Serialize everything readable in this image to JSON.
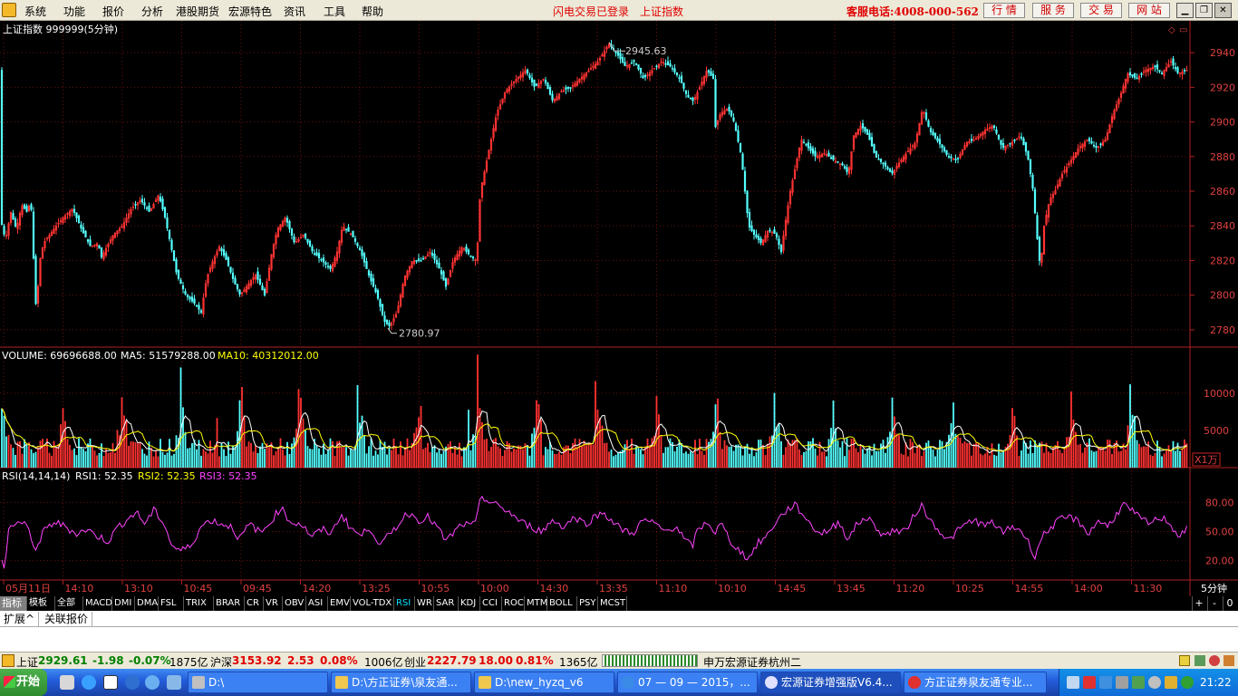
{
  "menubar": {
    "items": [
      "系统",
      "功能",
      "报价",
      "分析",
      "港股期货",
      "宏源特色",
      "资讯",
      "工具",
      "帮助"
    ],
    "flash_login": "闪电交易已登录",
    "index_name": "上证指数",
    "hotline": "客服电话:4008-000-562",
    "buttons": [
      "行 情",
      "服 务",
      "交 易",
      "网 站"
    ],
    "window_icons": [
      "minimize-icon",
      "restore-icon",
      "close-icon"
    ]
  },
  "chart_data": [
    {
      "type": "candlestick",
      "name": "main",
      "title": "上证指数 999999(5分钟)",
      "ylim": [
        2770,
        2950
      ],
      "yticks": [
        2780,
        2800,
        2820,
        2840,
        2860,
        2880,
        2900,
        2920,
        2940
      ],
      "high_label": "2945.63",
      "low_label": "2780.97",
      "close_path": [
        [
          0,
          2845
        ],
        [
          6,
          2832
        ],
        [
          12,
          2848
        ],
        [
          18,
          2838
        ],
        [
          24,
          2852
        ],
        [
          30,
          2848
        ],
        [
          34,
          2855
        ],
        [
          38,
          2810
        ],
        [
          40,
          2790
        ],
        [
          44,
          2820
        ],
        [
          48,
          2830
        ],
        [
          55,
          2835
        ],
        [
          62,
          2840
        ],
        [
          70,
          2845
        ],
        [
          80,
          2850
        ],
        [
          90,
          2838
        ],
        [
          100,
          2828
        ],
        [
          108,
          2830
        ],
        [
          112,
          2822
        ],
        [
          118,
          2828
        ],
        [
          125,
          2835
        ],
        [
          135,
          2840
        ],
        [
          145,
          2850
        ],
        [
          155,
          2855
        ],
        [
          165,
          2848
        ],
        [
          175,
          2858
        ],
        [
          182,
          2845
        ],
        [
          190,
          2825
        ],
        [
          195,
          2812
        ],
        [
          205,
          2800
        ],
        [
          215,
          2795
        ],
        [
          222,
          2790
        ],
        [
          228,
          2810
        ],
        [
          235,
          2820
        ],
        [
          242,
          2828
        ],
        [
          250,
          2820
        ],
        [
          258,
          2808
        ],
        [
          265,
          2800
        ],
        [
          272,
          2805
        ],
        [
          282,
          2812
        ],
        [
          292,
          2800
        ],
        [
          300,
          2825
        ],
        [
          306,
          2838
        ],
        [
          315,
          2845
        ],
        [
          325,
          2830
        ],
        [
          335,
          2835
        ],
        [
          345,
          2825
        ],
        [
          355,
          2820
        ],
        [
          365,
          2815
        ],
        [
          372,
          2825
        ],
        [
          378,
          2840
        ],
        [
          388,
          2835
        ],
        [
          398,
          2825
        ],
        [
          408,
          2810
        ],
        [
          416,
          2800
        ],
        [
          424,
          2785
        ],
        [
          430,
          2782
        ],
        [
          438,
          2790
        ],
        [
          446,
          2810
        ],
        [
          455,
          2820
        ],
        [
          465,
          2820
        ],
        [
          475,
          2825
        ],
        [
          485,
          2815
        ],
        [
          492,
          2805
        ],
        [
          500,
          2820
        ],
        [
          510,
          2828
        ],
        [
          520,
          2822
        ],
        [
          526,
          2820
        ],
        [
          530,
          2860
        ],
        [
          540,
          2885
        ],
        [
          548,
          2905
        ],
        [
          558,
          2918
        ],
        [
          570,
          2925
        ],
        [
          580,
          2930
        ],
        [
          590,
          2920
        ],
        [
          600,
          2925
        ],
        [
          610,
          2912
        ],
        [
          620,
          2918
        ],
        [
          630,
          2920
        ],
        [
          640,
          2925
        ],
        [
          650,
          2930
        ],
        [
          660,
          2935
        ],
        [
          668,
          2942
        ],
        [
          672,
          2945
        ],
        [
          680,
          2940
        ],
        [
          690,
          2932
        ],
        [
          700,
          2935
        ],
        [
          710,
          2925
        ],
        [
          720,
          2930
        ],
        [
          730,
          2935
        ],
        [
          740,
          2932
        ],
        [
          750,
          2925
        ],
        [
          758,
          2915
        ],
        [
          765,
          2912
        ],
        [
          772,
          2920
        ],
        [
          780,
          2930
        ],
        [
          787,
          2925
        ],
        [
          788,
          2895
        ],
        [
          795,
          2905
        ],
        [
          803,
          2908
        ],
        [
          810,
          2900
        ],
        [
          818,
          2880
        ],
        [
          822,
          2860
        ],
        [
          826,
          2840
        ],
        [
          832,
          2835
        ],
        [
          840,
          2830
        ],
        [
          848,
          2838
        ],
        [
          856,
          2835
        ],
        [
          862,
          2825
        ],
        [
          866,
          2840
        ],
        [
          872,
          2860
        ],
        [
          878,
          2875
        ],
        [
          884,
          2890
        ],
        [
          892,
          2885
        ],
        [
          900,
          2880
        ],
        [
          910,
          2882
        ],
        [
          920,
          2878
        ],
        [
          930,
          2875
        ],
        [
          936,
          2870
        ],
        [
          942,
          2892
        ],
        [
          950,
          2898
        ],
        [
          958,
          2892
        ],
        [
          966,
          2880
        ],
        [
          976,
          2875
        ],
        [
          984,
          2870
        ],
        [
          990,
          2875
        ],
        [
          1000,
          2882
        ],
        [
          1010,
          2888
        ],
        [
          1018,
          2908
        ],
        [
          1026,
          2895
        ],
        [
          1036,
          2888
        ],
        [
          1046,
          2880
        ],
        [
          1056,
          2878
        ],
        [
          1066,
          2888
        ],
        [
          1076,
          2890
        ],
        [
          1086,
          2895
        ],
        [
          1096,
          2898
        ],
        [
          1106,
          2885
        ],
        [
          1116,
          2888
        ],
        [
          1126,
          2892
        ],
        [
          1134,
          2880
        ],
        [
          1140,
          2860
        ],
        [
          1144,
          2835
        ],
        [
          1148,
          2815
        ],
        [
          1152,
          2840
        ],
        [
          1158,
          2855
        ],
        [
          1164,
          2860
        ],
        [
          1172,
          2870
        ],
        [
          1182,
          2878
        ],
        [
          1190,
          2885
        ],
        [
          1200,
          2890
        ],
        [
          1210,
          2885
        ],
        [
          1220,
          2890
        ],
        [
          1228,
          2905
        ],
        [
          1236,
          2915
        ],
        [
          1244,
          2928
        ],
        [
          1254,
          2925
        ],
        [
          1264,
          2930
        ],
        [
          1274,
          2932
        ],
        [
          1282,
          2928
        ],
        [
          1292,
          2935
        ],
        [
          1300,
          2928
        ],
        [
          1310,
          2930
        ]
      ]
    },
    {
      "type": "bar",
      "name": "volume",
      "label": "VOLUME: 69696688.00",
      "ma5_label": "MA5: 51579288.00",
      "ma10_label": "MA10: 40312012.00",
      "unit": "X1万",
      "yticks": [
        5000,
        10000
      ],
      "ymax": 14000
    },
    {
      "type": "line",
      "name": "rsi",
      "label": "RSI(14,14,14)",
      "rsi1": "RSI1: 52.35",
      "rsi2": "RSI2: 52.35",
      "rsi3": "RSI3: 52.35",
      "yticks": [
        "20.00",
        "50.00",
        "80.00"
      ],
      "path": [
        [
          0,
          30
        ],
        [
          5,
          10
        ],
        [
          10,
          55
        ],
        [
          20,
          60
        ],
        [
          30,
          55
        ],
        [
          40,
          30
        ],
        [
          48,
          50
        ],
        [
          60,
          60
        ],
        [
          72,
          55
        ],
        [
          84,
          48
        ],
        [
          96,
          52
        ],
        [
          108,
          45
        ],
        [
          120,
          40
        ],
        [
          130,
          55
        ],
        [
          140,
          62
        ],
        [
          150,
          70
        ],
        [
          160,
          58
        ],
        [
          170,
          72
        ],
        [
          180,
          60
        ],
        [
          190,
          35
        ],
        [
          200,
          30
        ],
        [
          210,
          35
        ],
        [
          222,
          55
        ],
        [
          232,
          62
        ],
        [
          244,
          58
        ],
        [
          256,
          55
        ],
        [
          264,
          42
        ],
        [
          276,
          58
        ],
        [
          288,
          48
        ],
        [
          300,
          62
        ],
        [
          310,
          75
        ],
        [
          320,
          60
        ],
        [
          332,
          58
        ],
        [
          344,
          45
        ],
        [
          356,
          52
        ],
        [
          366,
          48
        ],
        [
          376,
          68
        ],
        [
          386,
          55
        ],
        [
          398,
          45
        ],
        [
          408,
          55
        ],
        [
          420,
          35
        ],
        [
          428,
          45
        ],
        [
          440,
          58
        ],
        [
          450,
          70
        ],
        [
          462,
          62
        ],
        [
          472,
          65
        ],
        [
          482,
          55
        ],
        [
          492,
          40
        ],
        [
          500,
          48
        ],
        [
          510,
          58
        ],
        [
          520,
          55
        ],
        [
          526,
          60
        ],
        [
          530,
          88
        ],
        [
          540,
          80
        ],
        [
          550,
          76
        ],
        [
          562,
          70
        ],
        [
          574,
          60
        ],
        [
          586,
          55
        ],
        [
          598,
          50
        ],
        [
          610,
          62
        ],
        [
          622,
          55
        ],
        [
          634,
          65
        ],
        [
          646,
          58
        ],
        [
          656,
          65
        ],
        [
          666,
          70
        ],
        [
          676,
          60
        ],
        [
          686,
          52
        ],
        [
          698,
          48
        ],
        [
          710,
          62
        ],
        [
          722,
          58
        ],
        [
          734,
          50
        ],
        [
          746,
          56
        ],
        [
          756,
          40
        ],
        [
          764,
          35
        ],
        [
          770,
          52
        ],
        [
          782,
          60
        ],
        [
          788,
          48
        ],
        [
          796,
          58
        ],
        [
          806,
          40
        ],
        [
          816,
          30
        ],
        [
          826,
          22
        ],
        [
          836,
          38
        ],
        [
          846,
          45
        ],
        [
          856,
          60
        ],
        [
          866,
          70
        ],
        [
          876,
          78
        ],
        [
          886,
          68
        ],
        [
          896,
          55
        ],
        [
          906,
          48
        ],
        [
          916,
          52
        ],
        [
          926,
          60
        ],
        [
          936,
          42
        ],
        [
          946,
          58
        ],
        [
          956,
          65
        ],
        [
          966,
          55
        ],
        [
          976,
          45
        ],
        [
          986,
          52
        ],
        [
          996,
          48
        ],
        [
          1006,
          62
        ],
        [
          1016,
          78
        ],
        [
          1026,
          62
        ],
        [
          1036,
          52
        ],
        [
          1046,
          40
        ],
        [
          1056,
          50
        ],
        [
          1066,
          58
        ],
        [
          1076,
          62
        ],
        [
          1086,
          55
        ],
        [
          1096,
          60
        ],
        [
          1106,
          48
        ],
        [
          1116,
          55
        ],
        [
          1126,
          52
        ],
        [
          1134,
          40
        ],
        [
          1142,
          25
        ],
        [
          1150,
          45
        ],
        [
          1160,
          55
        ],
        [
          1170,
          62
        ],
        [
          1182,
          65
        ],
        [
          1192,
          58
        ],
        [
          1202,
          48
        ],
        [
          1212,
          62
        ],
        [
          1222,
          55
        ],
        [
          1232,
          68
        ],
        [
          1240,
          78
        ],
        [
          1250,
          70
        ],
        [
          1260,
          62
        ],
        [
          1270,
          58
        ],
        [
          1280,
          65
        ],
        [
          1290,
          60
        ],
        [
          1300,
          45
        ],
        [
          1308,
          52
        ]
      ]
    },
    {
      "type": "axis",
      "name": "time",
      "labels": [
        "05月11日",
        "14:10",
        "13:10",
        "10:45",
        "09:45",
        "14:20",
        "13:25",
        "10:55",
        "10:00",
        "14:30",
        "13:35",
        "11:10",
        "10:10",
        "14:45",
        "13:45",
        "11:20",
        "10:25",
        "14:55",
        "14:00",
        "11:30"
      ],
      "period": "5分钟"
    }
  ],
  "tabs": {
    "items": [
      "指标",
      "模板",
      "全部",
      "MACD",
      "DMI",
      "DMA",
      "FSL",
      "TRIX",
      "BRAR",
      "CR",
      "VR",
      "OBV",
      "ASI",
      "EMV",
      "VOL-TDX",
      "RSI",
      "WR",
      "SAR",
      "KDJ",
      "CCI",
      "ROC",
      "MTM",
      "BOLL",
      "PSY",
      "MCST"
    ],
    "active": "RSI",
    "zoom": [
      "+",
      "-",
      "0"
    ]
  },
  "subtabs": [
    "扩展^",
    "关联报价"
  ],
  "status": {
    "sh_label": "上证",
    "sh_price": "2929.61",
    "sh_chg": "-1.98",
    "sh_pct": "-0.07%",
    "sh_amt": "1875亿",
    "hs_label": "沪深",
    "hs_price": "3153.92",
    "hs_chg": "2.53",
    "hs_pct": "0.08%",
    "hs_amt": "1006亿",
    "cy_label": "创业",
    "cy_price": "2227.79",
    "cy_chg": "18.00",
    "cy_pct": "0.81%",
    "cy_amt": "1365亿",
    "broker": "申万宏源证券杭州二"
  },
  "taskbar": {
    "start": "开始",
    "tasks": [
      "D:\\",
      "D:\\方正证券\\泉友通...",
      "D:\\new_hyzq_v6",
      "07 — 09 — 2015，...",
      "宏源证券增强版V6.4...",
      "方正证券泉友通专业..."
    ],
    "clock": "21:22"
  }
}
